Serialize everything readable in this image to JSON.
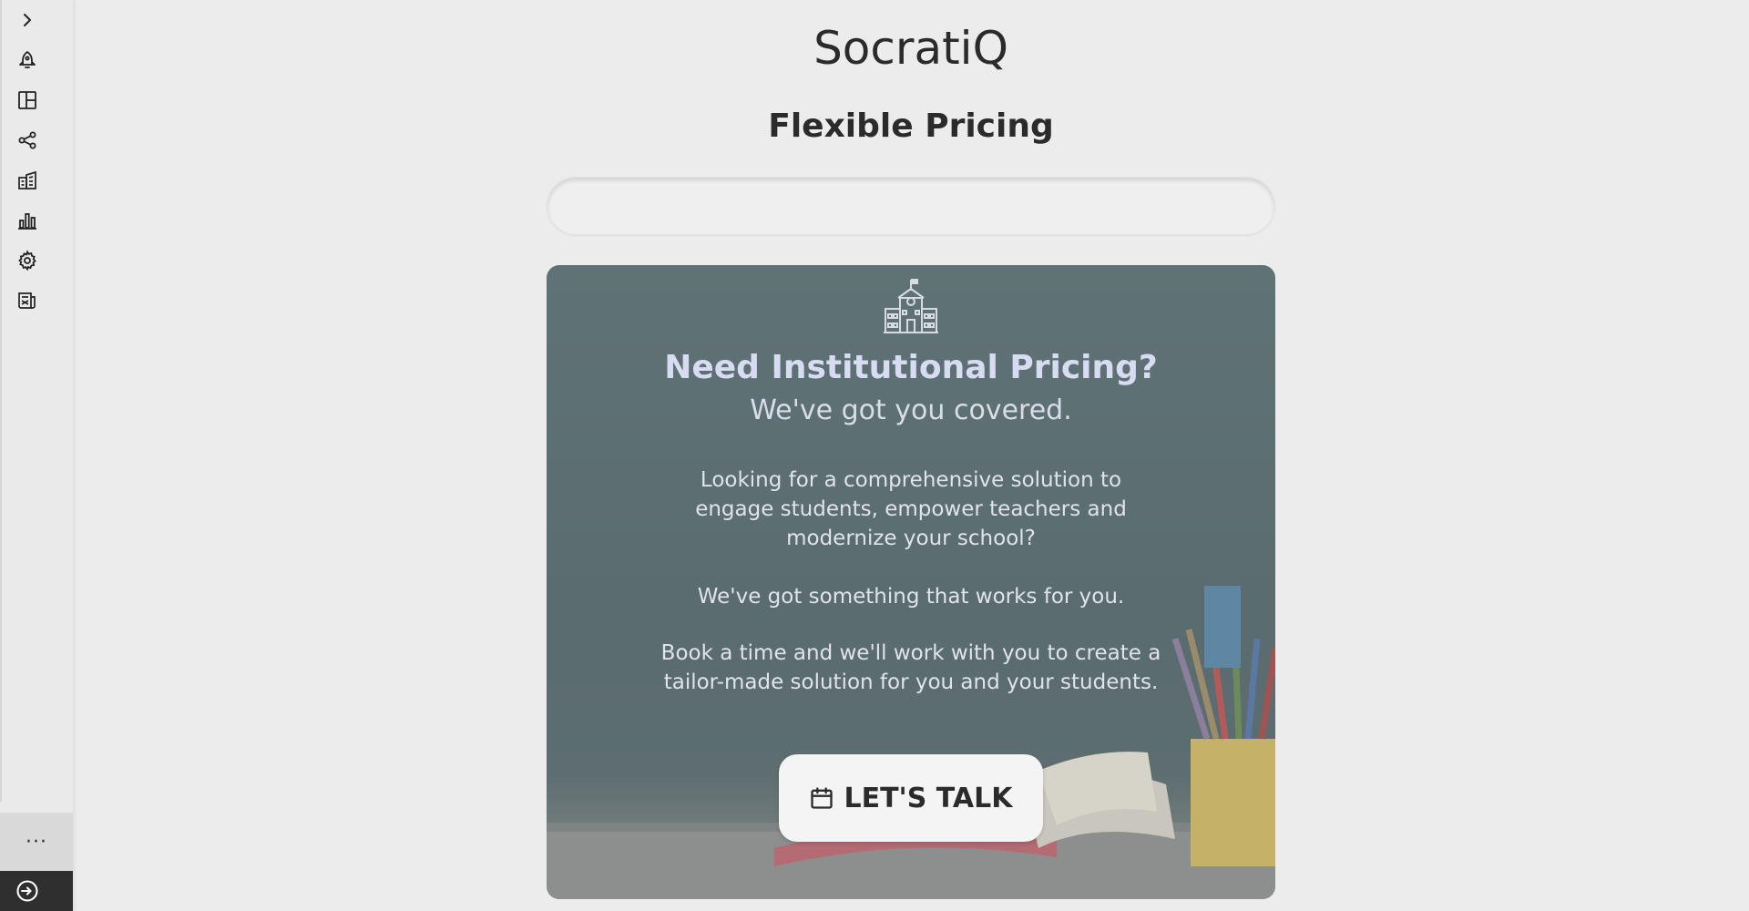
{
  "app": {
    "title": "SocratiQ"
  },
  "sidebar": {
    "items": [
      {
        "icon": "chevron-right-icon"
      },
      {
        "icon": "rocket-icon"
      },
      {
        "icon": "layout-icon"
      },
      {
        "icon": "share-icon"
      },
      {
        "icon": "buildings-icon"
      },
      {
        "icon": "bar-chart-icon"
      },
      {
        "icon": "gear-icon"
      },
      {
        "icon": "news-icon"
      }
    ],
    "more_label": "···",
    "logout_icon": "logout-icon"
  },
  "main": {
    "page_title": "Flexible Pricing",
    "card": {
      "heading": "Need Institutional Pricing?",
      "subheading": "We've got you covered.",
      "para1_line1": "Looking for a comprehensive solution to",
      "para1_line2": "engage students, empower teachers and",
      "para1_line3": "modernize your school?",
      "para2": "We've got something that works for you.",
      "para3_line1": "Book a time and we'll work with you to create a",
      "para3_line2": "tailor-made solution for you and your students.",
      "cta_label": "LET'S TALK"
    }
  },
  "colors": {
    "background": "#ececec",
    "card_overlay": "#5f7275",
    "heading_text": "#d8dcf2",
    "logout_bg": "#2f2f2f"
  }
}
